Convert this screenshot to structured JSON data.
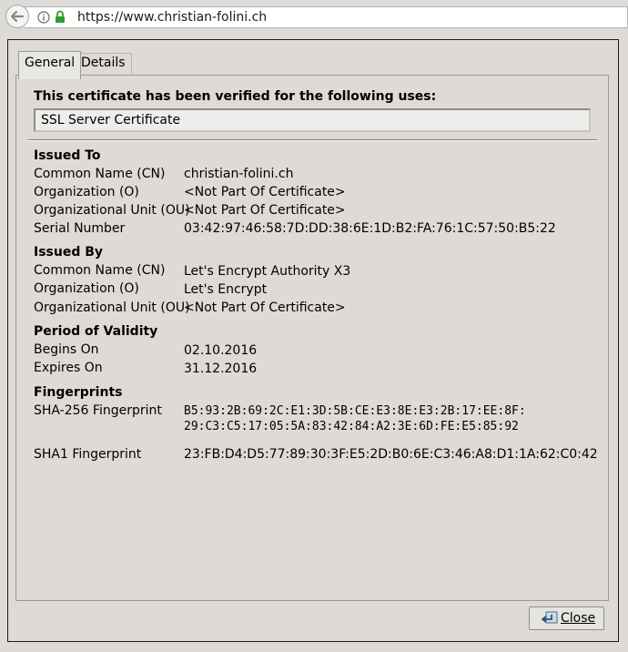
{
  "browser": {
    "url": "https://www.christian-folini.ch"
  },
  "tabs": {
    "general": "General",
    "details": "Details"
  },
  "uses": {
    "heading": "This certificate has been verified for the following uses:",
    "value": "SSL Server Certificate"
  },
  "issued_to": {
    "heading": "Issued To",
    "rows": [
      {
        "label": "Common Name (CN)",
        "value": "christian-folini.ch"
      },
      {
        "label": "Organization (O)",
        "value": "<Not Part Of Certificate>"
      },
      {
        "label": "Organizational Unit (OU)",
        "value": "<Not Part Of Certificate>"
      },
      {
        "label": "Serial Number",
        "value": "03:42:97:46:58:7D:DD:38:6E:1D:B2:FA:76:1C:57:50:B5:22"
      }
    ]
  },
  "issued_by": {
    "heading": "Issued By",
    "rows": [
      {
        "label": "Common Name (CN)",
        "value": "Let's Encrypt Authority X3"
      },
      {
        "label": "Organization (O)",
        "value": "Let's Encrypt"
      },
      {
        "label": "Organizational Unit (OU)",
        "value": "<Not Part Of Certificate>"
      }
    ]
  },
  "validity": {
    "heading": "Period of Validity",
    "rows": [
      {
        "label": "Begins On",
        "value": "02.10.2016"
      },
      {
        "label": "Expires On",
        "value": "31.12.2016"
      }
    ]
  },
  "fingerprints": {
    "heading": "Fingerprints",
    "sha256_label": "SHA-256 Fingerprint",
    "sha256_line1": "B5:93:2B:69:2C:E1:3D:5B:CE:E3:8E:E3:2B:17:EE:8F:",
    "sha256_line2": "29:C3:C5:17:05:5A:83:42:84:A2:3E:6D:FE:E5:85:92",
    "sha1_label": "SHA1 Fingerprint",
    "sha1_value": "23:FB:D4:D5:77:89:30:3F:E5:2D:B0:6E:C3:46:A8:D1:1A:62:C0:42"
  },
  "buttons": {
    "close": "Close"
  },
  "icons": {
    "back": "back-arrow-icon",
    "info": "info-icon",
    "lock": "lock-icon",
    "close": "close-dialog-icon"
  },
  "colors": {
    "lock": "#2e9e2e",
    "dialog_bg": "#dedbd6"
  }
}
